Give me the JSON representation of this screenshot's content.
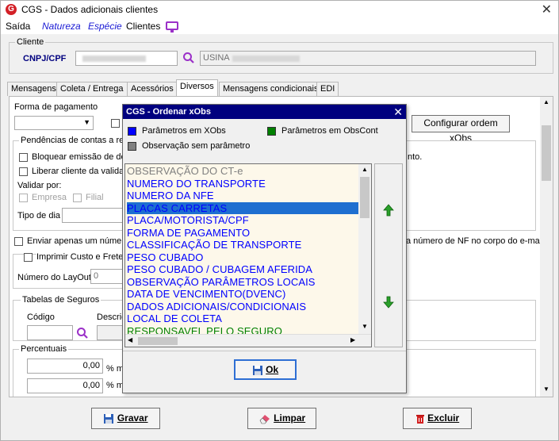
{
  "window": {
    "title": "CGS - Dados adicionais clientes",
    "close": "✕"
  },
  "menu": {
    "saida": "Saída",
    "natureza": "Natureza",
    "especie": "Espécie",
    "clientes": "Clientes"
  },
  "cliente": {
    "group_label": "Cliente",
    "cnpj_label": "CNPJ/CPF",
    "name_value": "USINA"
  },
  "tabs": [
    {
      "label": "Mensagens"
    },
    {
      "label": "Coleta / Entrega"
    },
    {
      "label": "Acessórios"
    },
    {
      "label": "Diversos"
    },
    {
      "label": "Mensagens condicionais"
    },
    {
      "label": "EDI"
    }
  ],
  "diversos": {
    "forma_pagamento": "Forma de pagamento",
    "configurar_btn": "Configurar ordem xObs",
    "pendencias_label": "Pendências de contas a re",
    "bloquear": "Bloquear emissão de doc",
    "liberar": "Liberar cliente da validaç",
    "validar_por": "Validar por:",
    "empresa": "Empresa",
    "filial": "Filial",
    "tipo_dia": "Tipo de dia",
    "right_text1": "nto.",
    "enviar": "Enviar apenas um número",
    "right_text2": "a número de NF no corpo do e-mail",
    "imprimir": "Imprimir Custo e Frete p",
    "numero_layout": "Número do LayOut",
    "layout_value": "0",
    "tabelas": "Tabelas de Seguros",
    "codigo": "Código",
    "descricao": "Descriç",
    "percentuais": "Percentuais",
    "pct1": "0,00",
    "pct2": "0,00",
    "pct_suffix": "% m"
  },
  "buttons": {
    "gravar": "Gravar",
    "limpar": "Limpar",
    "excluir": "Excluir"
  },
  "dialog": {
    "title": "CGS - Ordenar xObs",
    "close": "✕",
    "legend_xobs": "Parâmetros em XObs",
    "legend_obscont": "Parâmetros em ObsCont",
    "legend_sem": "Observação sem parâmetro",
    "items": [
      {
        "text": "OBSERVAÇÃO DO CT-e",
        "color": "#808080"
      },
      {
        "text": "NUMERO DO TRANSPORTE",
        "color": "#0000ff"
      },
      {
        "text": "NUMERO DA NFE",
        "color": "#0000ff"
      },
      {
        "text": "PLACAS CARRETAS",
        "color": "#0000ff"
      },
      {
        "text": "PLACA/MOTORISTA/CPF",
        "color": "#0000ff"
      },
      {
        "text": "FORMA DE PAGAMENTO",
        "color": "#0000ff"
      },
      {
        "text": "CLASSIFICAÇÃO DE TRANSPORTE",
        "color": "#0000ff"
      },
      {
        "text": "PESO CUBADO",
        "color": "#0000ff"
      },
      {
        "text": "PESO CUBADO / CUBAGEM AFERIDA",
        "color": "#0000ff"
      },
      {
        "text": "OBSERVAÇÃO PARÂMETROS LOCAIS",
        "color": "#0000ff"
      },
      {
        "text": "DATA DE VENCIMENTO(DVENC)",
        "color": "#0000ff"
      },
      {
        "text": "DADOS ADICIONAIS/CONDICIONAIS",
        "color": "#0000ff"
      },
      {
        "text": "LOCAL DE COLETA",
        "color": "#0000ff"
      },
      {
        "text": "RESPONSAVEL PELO SEGURO",
        "color": "#008000"
      }
    ],
    "selected_index": 3,
    "ok": "Ok"
  },
  "colors": {
    "xobs": "#0000ff",
    "obscont": "#008000",
    "sem": "#808080",
    "selection": "#1e6fd0",
    "dialog_title": "#00007f"
  }
}
